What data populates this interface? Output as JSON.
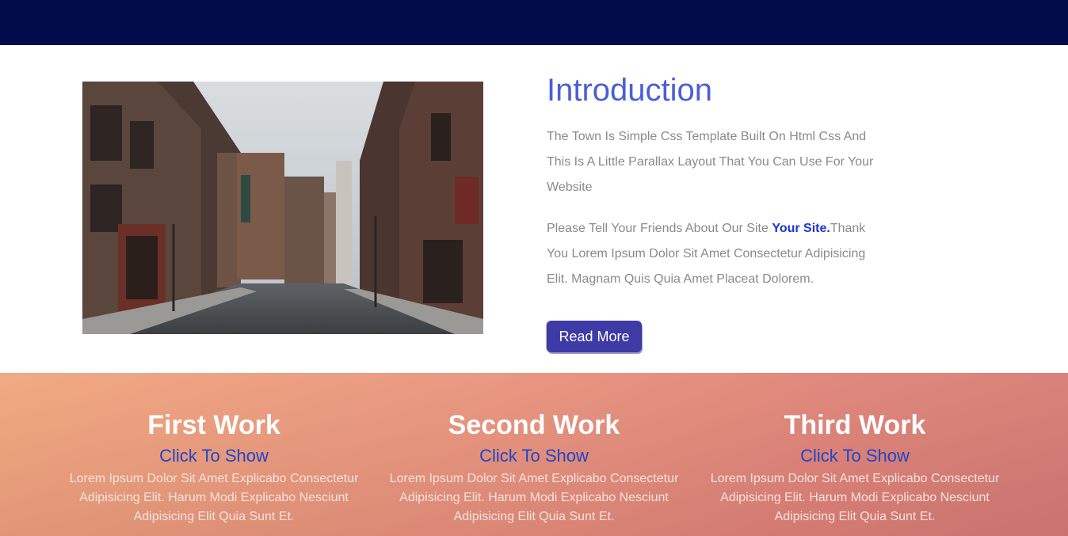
{
  "colors": {
    "topbar": "#030c4a",
    "accent_title": "#4a5fd6",
    "link": "#1a36d6",
    "button": "#3e3aa6",
    "works_gradient_start": "#f0a57a",
    "works_gradient_end": "#d47a72"
  },
  "intro": {
    "image_alt": "street-photo",
    "title": "Introduction",
    "paragraph1": "The Town Is Simple Css Template Built On Html Css And This Is A Little Parallax Layout That You Can Use For Your Website",
    "paragraph2_before": "Please Tell Your Friends About Our Site ",
    "paragraph2_link": "Your Site.",
    "paragraph2_after": "Thank You Lorem Ipsum Dolor Sit Amet Consectetur Adipisicing Elit. Magnam Quis Quia Amet Placeat Dolorem.",
    "button_label": "Read More"
  },
  "works": [
    {
      "title": "First Work",
      "link": "Click To Show",
      "description": "Lorem Ipsum Dolor Sit Amet Explicabo Consectetur Adipisicing Elit. Harum Modi Explicabo Nesciunt Adipisicing Elit Quia Sunt Et."
    },
    {
      "title": "Second Work",
      "link": "Click To Show",
      "description": "Lorem Ipsum Dolor Sit Amet Explicabo Consectetur Adipisicing Elit. Harum Modi Explicabo Nesciunt Adipisicing Elit Quia Sunt Et."
    },
    {
      "title": "Third Work",
      "link": "Click To Show",
      "description": "Lorem Ipsum Dolor Sit Amet Explicabo Consectetur Adipisicing Elit. Harum Modi Explicabo Nesciunt Adipisicing Elit Quia Sunt Et."
    }
  ]
}
